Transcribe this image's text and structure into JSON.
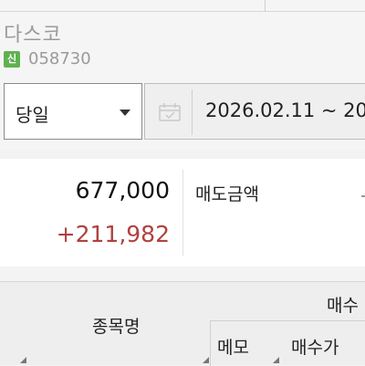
{
  "stock": {
    "name": "다스코",
    "badge": "신",
    "code": "058730"
  },
  "controls": {
    "period_label": "당일",
    "date_range": "2026.02.11 ~ 20",
    "icons": [
      "calendar-icon",
      "chevron-down-icon"
    ]
  },
  "summary": {
    "amount": "677,000",
    "profit": "+211,982",
    "sell_amount_label": "매도금액"
  },
  "table_header": {
    "name_col": "종목명",
    "buy_group": "매수",
    "memo_col": "메모",
    "buy_price_col": "매수가"
  },
  "colors": {
    "profit": "#b0413e",
    "badge": "#5fb150",
    "muted_text": "#9a9a9a"
  }
}
